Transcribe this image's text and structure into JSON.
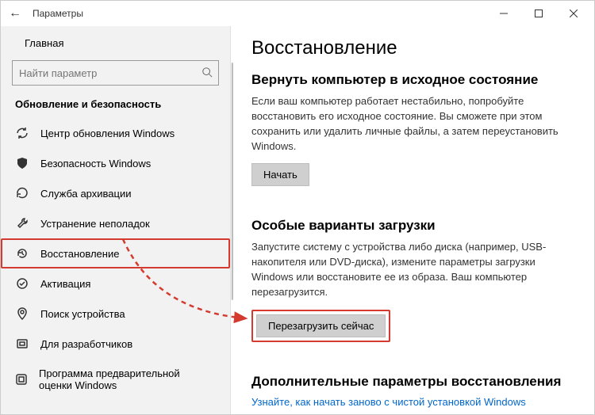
{
  "titlebar": {
    "title": "Параметры"
  },
  "sidebar": {
    "home_label": "Главная",
    "search_placeholder": "Найти параметр",
    "section_heading": "Обновление и безопасность",
    "items": [
      {
        "label": "Центр обновления Windows"
      },
      {
        "label": "Безопасность Windows"
      },
      {
        "label": "Служба архивации"
      },
      {
        "label": "Устранение неполадок"
      },
      {
        "label": "Восстановление"
      },
      {
        "label": "Активация"
      },
      {
        "label": "Поиск устройства"
      },
      {
        "label": "Для разработчиков"
      },
      {
        "label": "Программа предварительной оценки Windows"
      }
    ]
  },
  "main": {
    "title": "Восстановление",
    "sections": [
      {
        "heading": "Вернуть компьютер в исходное состояние",
        "body": "Если ваш компьютер работает нестабильно, попробуйте восстановить его исходное состояние. Вы сможете при этом сохранить или удалить личные файлы, а затем переустановить Windows.",
        "button": "Начать"
      },
      {
        "heading": "Особые варианты загрузки",
        "body": "Запустите систему с устройства либо диска (например, USB-накопителя или DVD-диска), измените параметры загрузки Windows или восстановите ее из образа. Ваш компьютер перезагрузится.",
        "button": "Перезагрузить сейчас"
      },
      {
        "heading": "Дополнительные параметры восстановления",
        "link": "Узнайте, как начать заново с чистой установкой Windows"
      }
    ]
  }
}
